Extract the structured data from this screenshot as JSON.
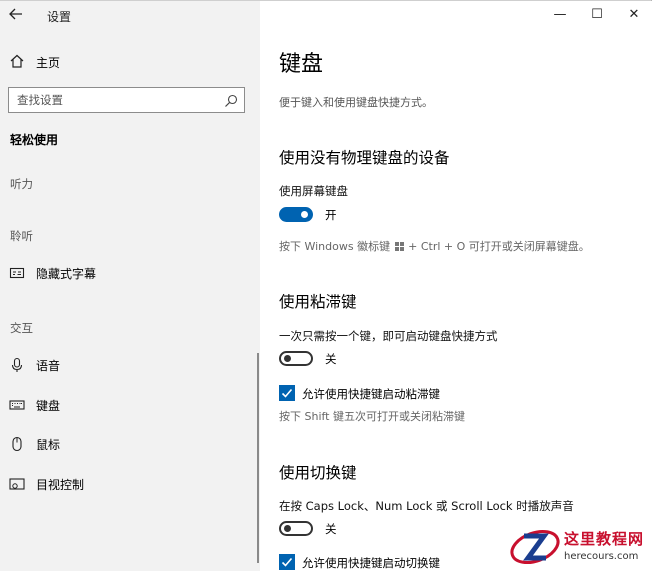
{
  "window": {
    "title": "设置",
    "controls": {
      "minimize": "—",
      "maximize": "☐",
      "close": "✕"
    }
  },
  "sidebar": {
    "home_label": "主页",
    "search_placeholder": "查找设置",
    "current_section": "轻松使用",
    "groups": {
      "vision": "听力",
      "hearing": "聆听",
      "interaction": "交互"
    },
    "items": [
      {
        "label": "隐藏式字幕",
        "icon": "closed-caption-icon"
      },
      {
        "label": "语音",
        "icon": "microphone-icon"
      },
      {
        "label": "键盘",
        "icon": "keyboard-icon"
      },
      {
        "label": "鼠标",
        "icon": "mouse-icon"
      },
      {
        "label": "目视控制",
        "icon": "eye-control-icon"
      }
    ]
  },
  "content": {
    "title": "键盘",
    "description": "便于键入和使用键盘快捷方式。",
    "onscreen": {
      "heading": "使用没有物理键盘的设备",
      "toggle_label": "使用屏幕键盘",
      "toggle_state": "开",
      "toggle_on": true,
      "hint_before": "按下 Windows 徽标键",
      "hint_after": "+ Ctrl + O 可打开或关闭屏幕键盘。"
    },
    "sticky": {
      "heading": "使用粘滞键",
      "toggle_label": "一次只需按一个键，即可启动键盘快捷方式",
      "toggle_state": "关",
      "toggle_on": false,
      "checkbox_label": "允许使用快捷键启动粘滞键",
      "checkbox_checked": true,
      "hint": "按下 Shift 键五次可打开或关闭粘滞键"
    },
    "toggle_keys": {
      "heading": "使用切换键",
      "toggle_label": "在按 Caps Lock、Num Lock 或 Scroll Lock 时播放声音",
      "toggle_state": "关",
      "toggle_on": false,
      "checkbox_label": "允许使用快捷键启动切换键",
      "checkbox_checked": true
    }
  },
  "watermark": {
    "name": "这里教程网",
    "url": "herecours.com"
  },
  "colors": {
    "accent": "#0063b1",
    "sidebar_bg": "#f2f2f2",
    "content_bg": "#ffffff"
  }
}
